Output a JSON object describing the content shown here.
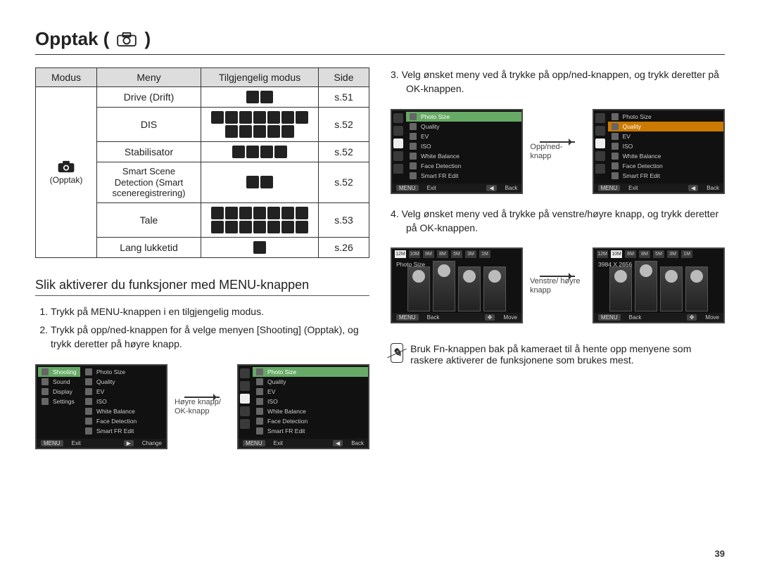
{
  "page": {
    "title_prefix": "Opptak (",
    "title_suffix": ")",
    "number": "39"
  },
  "table": {
    "headers": {
      "modus": "Modus",
      "meny": "Meny",
      "tilgjengelig": "Tilgjengelig modus",
      "side": "Side"
    },
    "mode_label": "(Opptak)",
    "rows": [
      {
        "meny": "Drive (Drift)",
        "icons": 2,
        "side": "s.51"
      },
      {
        "meny": "DIS",
        "icons": 12,
        "side": "s.52"
      },
      {
        "meny": "Stabilisator",
        "icons": 4,
        "side": "s.52"
      },
      {
        "meny": "Smart Scene Detection (Smart sceneregistrering)",
        "icons": 2,
        "side": "s.52"
      },
      {
        "meny": "Tale",
        "icons": 14,
        "side": "s.53"
      },
      {
        "meny": "Lang lukketid",
        "icons": 1,
        "side": "s.26"
      }
    ]
  },
  "left": {
    "section_heading": "Slik aktiverer du funksjoner med MENU-knappen",
    "step1": "Trykk på MENU-knappen i en tilgjengelig modus.",
    "step2": "Trykk på opp/ned-knappen for å velge menyen [Shooting] (Opptak), og trykk deretter på høyre knapp.",
    "arrow_caption": "Høyre knapp/ OK-knapp"
  },
  "right": {
    "step3_num": "3.",
    "step3": "Velg ønsket meny ved å trykke på opp/ned-knappen, og trykk deretter på OK-knappen.",
    "arrow3_caption": "Opp/ned- knapp",
    "step4_num": "4.",
    "step4": "Velg ønsket meny ved å trykke på venstre/høyre knapp, og trykk deretter på OK-knappen.",
    "arrow4_caption": "Venstre/ høyre knapp",
    "note": "Bruk Fn-knappen bak på kameraet til å hente opp menyene som raskere aktiverer de funksjonene som brukes mest."
  },
  "lcd": {
    "side_tabs": [
      "Shooting",
      "Sound",
      "Display",
      "Settings"
    ],
    "menu_items": [
      "Photo Size",
      "Quality",
      "EV",
      "ISO",
      "White Balance",
      "Face Detection",
      "Smart FR Edit"
    ],
    "photo_top_icons": [
      "12M",
      "10M",
      "8M",
      "8M",
      "5M",
      "3M",
      "1M"
    ],
    "photo_overlay_gray": "Photo Size",
    "photo_overlay_orange": "3984 X 2656",
    "foot_menu": "MENU",
    "foot_exit": "Exit",
    "foot_change": "Change",
    "foot_back": "Back",
    "foot_move": "Move"
  }
}
